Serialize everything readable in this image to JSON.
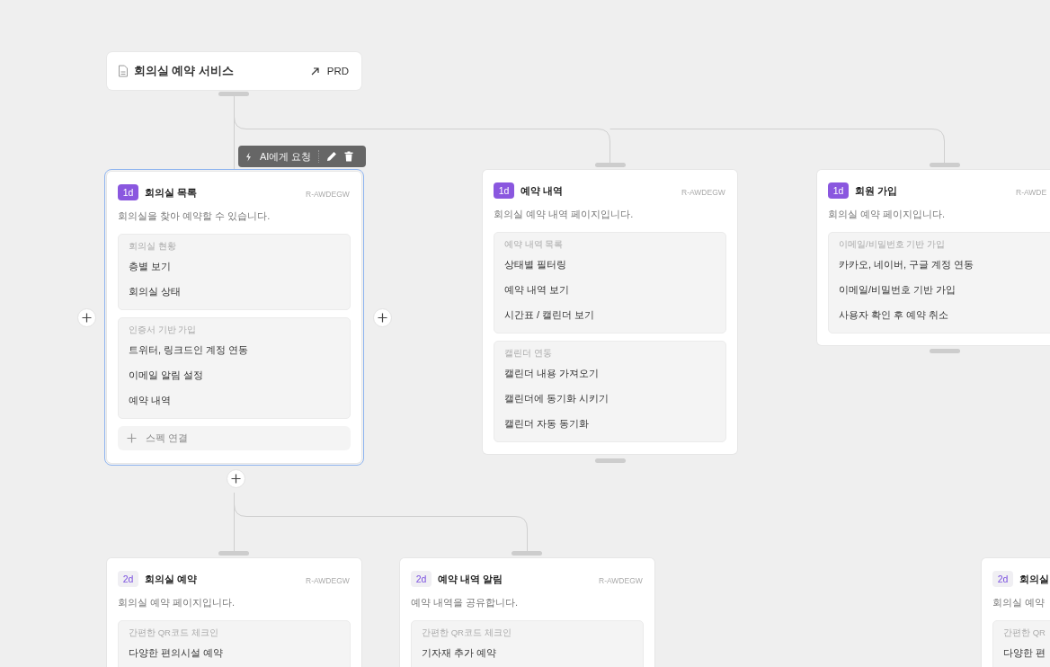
{
  "root": {
    "title": "회의실 예약 서비스",
    "link": "PRD"
  },
  "toolbar": {
    "ai_label": "AI에게 요청"
  },
  "cards": [
    {
      "badge": "1d",
      "kind": "filled",
      "title": "회의실 목록",
      "code": "R-AWDEGW",
      "description": "회의실을 찾아 예약할 수 있습니다.",
      "selected": true,
      "groups": [
        {
          "label": "회의실 현황",
          "items": [
            "층별 보기",
            "회의실 상태"
          ]
        },
        {
          "label": "인증서 기반 가입",
          "items": [
            "트위터, 링크드인 계정 연동",
            "이메일 알림 설정",
            "예약 내역"
          ]
        }
      ],
      "spec_link": "스펙 연결"
    },
    {
      "badge": "1d",
      "kind": "filled",
      "title": "예약 내역",
      "code": "R-AWDEGW",
      "description": "회의실 예약 내역 페이지입니다.",
      "selected": false,
      "groups": [
        {
          "label": "예약 내역 목록",
          "items": [
            "상태별 필터링",
            "예약 내역 보기",
            "시간표 / 캘린더 보기"
          ]
        },
        {
          "label": "캘린더 연동",
          "items": [
            "캘린더 내용 가져오기",
            "캘린더에 동기화 시키기",
            "캘린더 자동 동기화"
          ]
        }
      ]
    },
    {
      "badge": "1d",
      "kind": "filled",
      "title": "회원 가입",
      "code": "R-AWDE",
      "description": "회의실 예약 페이지입니다.",
      "selected": false,
      "groups": [
        {
          "label": "이메일/비밀번호 기반 가입",
          "items": [
            "카카오, 네이버, 구글 계정 연동",
            "이메일/비밀번호 기반 가입",
            "사용자 확인 후 예약 취소"
          ]
        }
      ]
    },
    {
      "badge": "2d",
      "kind": "light",
      "title": "회의실 예약",
      "code": "R-AWDEGW",
      "description": "회의실 예약 페이지입니다.",
      "selected": false,
      "groups": [
        {
          "label": "간편한 QR코드 체크인",
          "items": [
            "다양한 편의시설 예약"
          ]
        }
      ]
    },
    {
      "badge": "2d",
      "kind": "light",
      "title": "예약 내역 알림",
      "code": "R-AWDEGW",
      "description": "예약 내역을 공유합니다.",
      "selected": false,
      "groups": [
        {
          "label": "간편한 QR코드 체크인",
          "items": [
            "기자재 추가 예약"
          ]
        }
      ]
    },
    {
      "badge": "2d",
      "kind": "light",
      "title": "회의실",
      "description": "회의실 예약",
      "selected": false,
      "groups": [
        {
          "label": "간편한 QR",
          "items": [
            "다양한 편"
          ]
        }
      ]
    }
  ]
}
